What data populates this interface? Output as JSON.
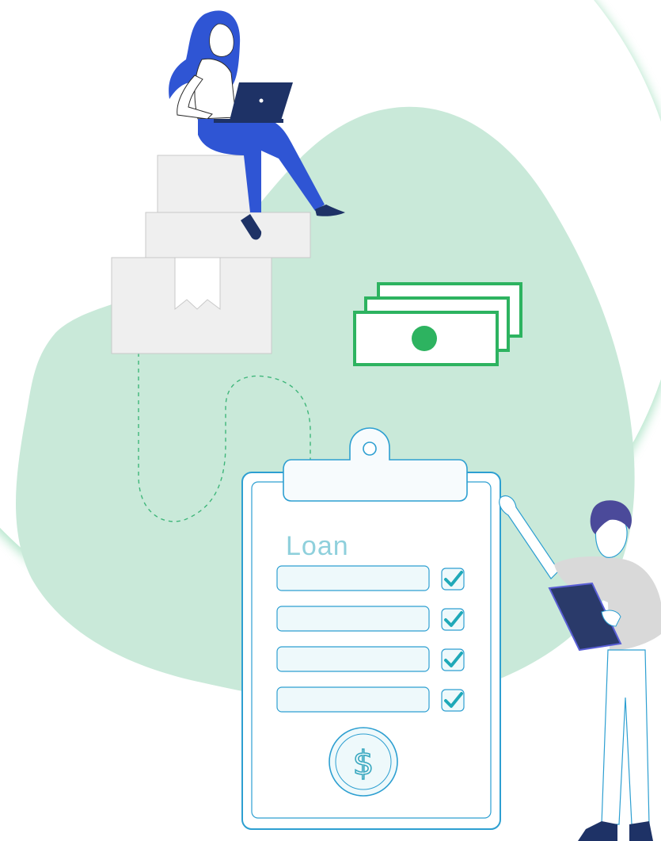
{
  "clipboard": {
    "title": "Loan",
    "rows": [
      {
        "checked": true
      },
      {
        "checked": true
      },
      {
        "checked": true
      },
      {
        "checked": true
      }
    ],
    "coin_symbol": "$"
  },
  "colors": {
    "blob": "#c9e9d9",
    "arc_shadow": "#7fd3a6",
    "money_green": "#2db360",
    "check_teal": "#1fa9b8",
    "clipboard_outline": "#2d9fd1",
    "woman_blue": "#2f55d4",
    "laptop_navy": "#1e3266",
    "box_gray": "#efefef"
  },
  "icons": [
    "dollar-icon",
    "checkmark-icon",
    "clipboard-icon",
    "banknote-icon",
    "box-icon"
  ]
}
